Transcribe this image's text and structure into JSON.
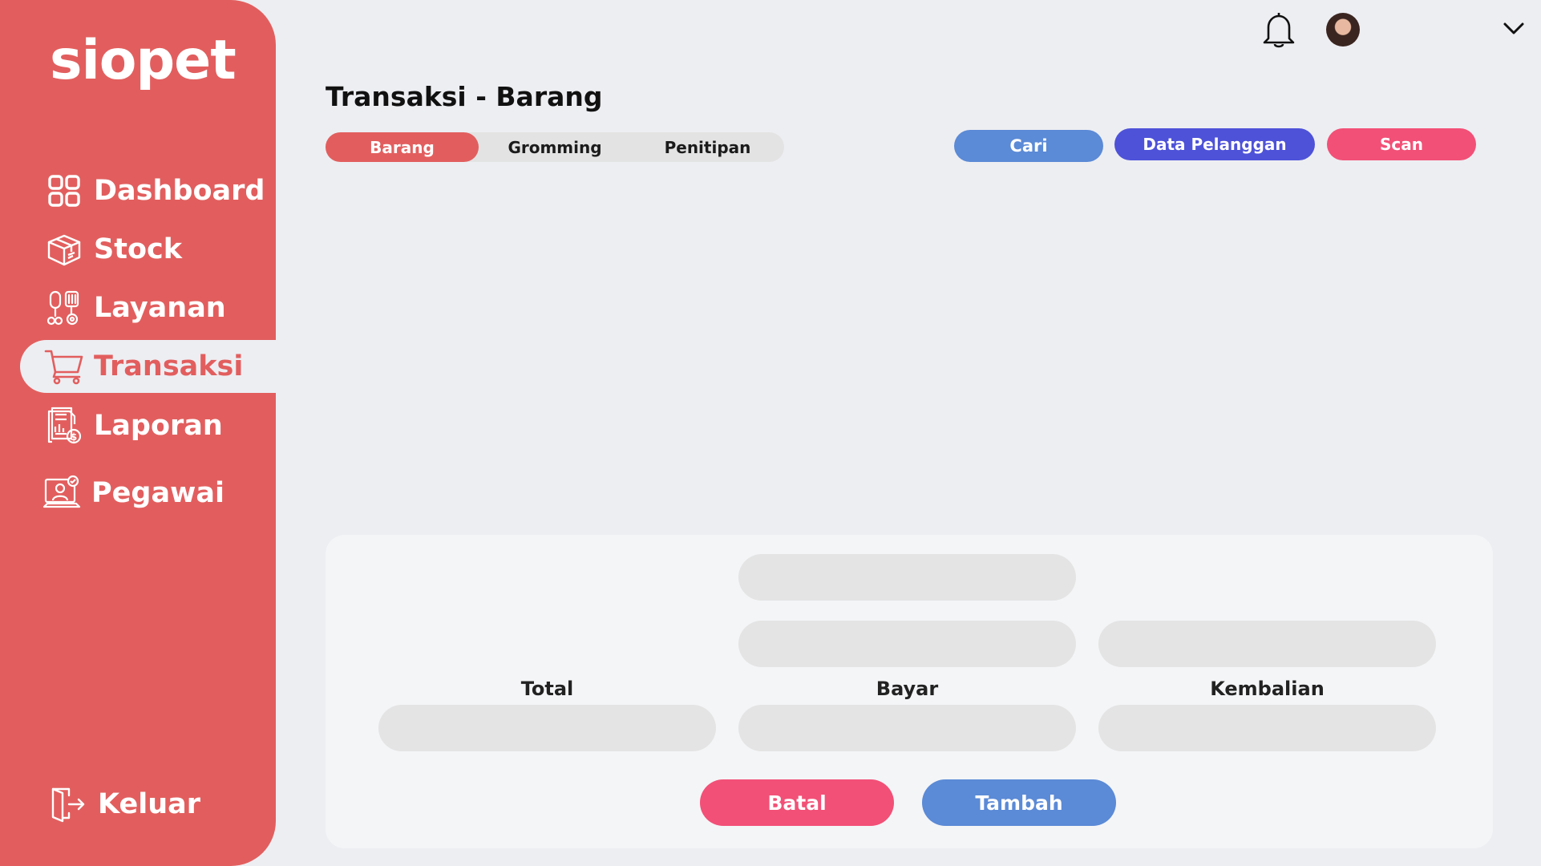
{
  "app": {
    "logo_text": "siopet"
  },
  "sidebar": {
    "items": [
      {
        "label": "Dashboard",
        "icon": "dashboard-icon"
      },
      {
        "label": "Stock",
        "icon": "box-icon"
      },
      {
        "label": "Layanan",
        "icon": "grooming-tools-icon"
      },
      {
        "label": "Transaksi",
        "icon": "cart-icon",
        "active": true
      },
      {
        "label": "Laporan",
        "icon": "report-icon"
      },
      {
        "label": "Pegawai",
        "icon": "employee-icon"
      }
    ],
    "logout": {
      "label": "Keluar",
      "icon": "logout-icon"
    }
  },
  "topbar": {
    "notification_icon": "bell-icon",
    "user_menu_icon": "chevron-down-icon"
  },
  "header": {
    "title": "Transaksi - Barang",
    "tabs": [
      {
        "label": "Barang",
        "active": true
      },
      {
        "label": "Gromming"
      },
      {
        "label": "Penitipan"
      }
    ],
    "actions": {
      "search_label": "Cari",
      "customer_label": "Data Pelanggan",
      "scan_label": "Scan"
    }
  },
  "form": {
    "total_label": "Total",
    "bayar_label": "Bayar",
    "kembalian_label": "Kembalian",
    "cancel_label": "Batal",
    "add_label": "Tambah"
  },
  "colors": {
    "sidebar": "#e25e5e",
    "background": "#edeef2",
    "search_button": "#5b8ad6",
    "customer_button": "#4e52d8",
    "scan_button": "#f25077",
    "cancel_button": "#f25077",
    "add_button": "#5b8ad6"
  }
}
